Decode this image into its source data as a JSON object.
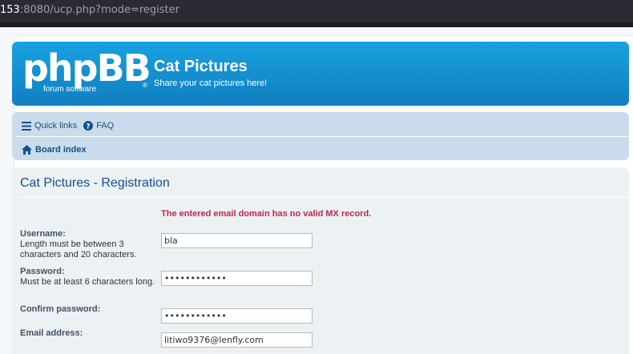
{
  "browser": {
    "url_host_fragment": "153",
    "url_rest": ":8080/ucp.php?mode=register"
  },
  "header": {
    "logo_text": "phpBB",
    "logo_sub": "forum software",
    "logo_reg": "®",
    "site_title": "Cat Pictures",
    "site_description": "Share your cat pictures here!"
  },
  "nav": {
    "quick_links": "Quick links",
    "faq": "FAQ",
    "board_index": "Board index",
    "icons": {
      "quick_links": "bars-icon",
      "faq": "question-circle-icon",
      "board_index": "home-icon"
    }
  },
  "page": {
    "title": "Cat Pictures - Registration",
    "error": "The entered email domain has no valid MX record."
  },
  "form": {
    "username": {
      "label": "Username:",
      "description": "Length must be between 3 characters and 20 characters.",
      "value": "bla"
    },
    "password": {
      "label": "Password:",
      "description": "Must be at least 6 characters long.",
      "value": "••••••••••••"
    },
    "confirm_password": {
      "label": "Confirm password:",
      "value": "••••••••••••"
    },
    "email": {
      "label": "Email address:",
      "value": "litiwo9376@lenfly.com"
    }
  },
  "colors": {
    "header_bg": "#0f7fc0",
    "nav_bg": "#cadceb",
    "panel_bg": "#ecf1f3",
    "title": "#115098",
    "error": "#bc2a4d",
    "link": "#105289"
  }
}
